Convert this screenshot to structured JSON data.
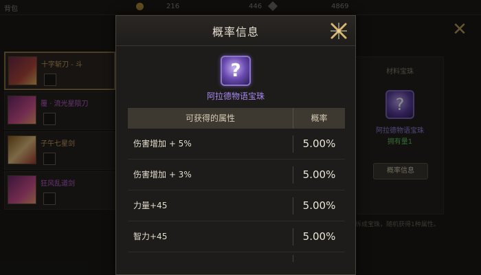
{
  "topbar": {
    "left_label": "背包",
    "coin_count": "216",
    "gem_count": "446",
    "crystal_count": "4869"
  },
  "background": {
    "items": [
      {
        "name": "十字斩刀 - 斗",
        "color": "#d0a060"
      },
      {
        "name": "覆 · 流光星陨刀",
        "color": "#c060d0"
      },
      {
        "name": "子午七星剑",
        "color": "#d0a060"
      },
      {
        "name": "狂风乱道剑",
        "color": "#c060d0"
      }
    ],
    "right_panel": {
      "title": "材料宝珠",
      "item_name": "阿拉德物语宝珠",
      "owned": "拥有量1",
      "button": "概率信息",
      "desc": "拆成宝珠，随机获得1种属性。"
    }
  },
  "modal": {
    "title": "概率信息",
    "item": {
      "name": "阿拉德物语宝珠",
      "icon": "question-orb-icon",
      "name_color": "#a788f0"
    },
    "table": {
      "header_attr": "可获得的属性",
      "header_prob": "概率",
      "rows": [
        {
          "attr": "伤害增加 + 5%",
          "prob": "5.00%"
        },
        {
          "attr": "伤害增加 + 3%",
          "prob": "5.00%"
        },
        {
          "attr": "力量+45",
          "prob": "5.00%"
        },
        {
          "attr": "智力+45",
          "prob": "5.00%"
        }
      ]
    }
  },
  "colors": {
    "accent_gold": "#c8a860",
    "purple": "#a788f0"
  }
}
